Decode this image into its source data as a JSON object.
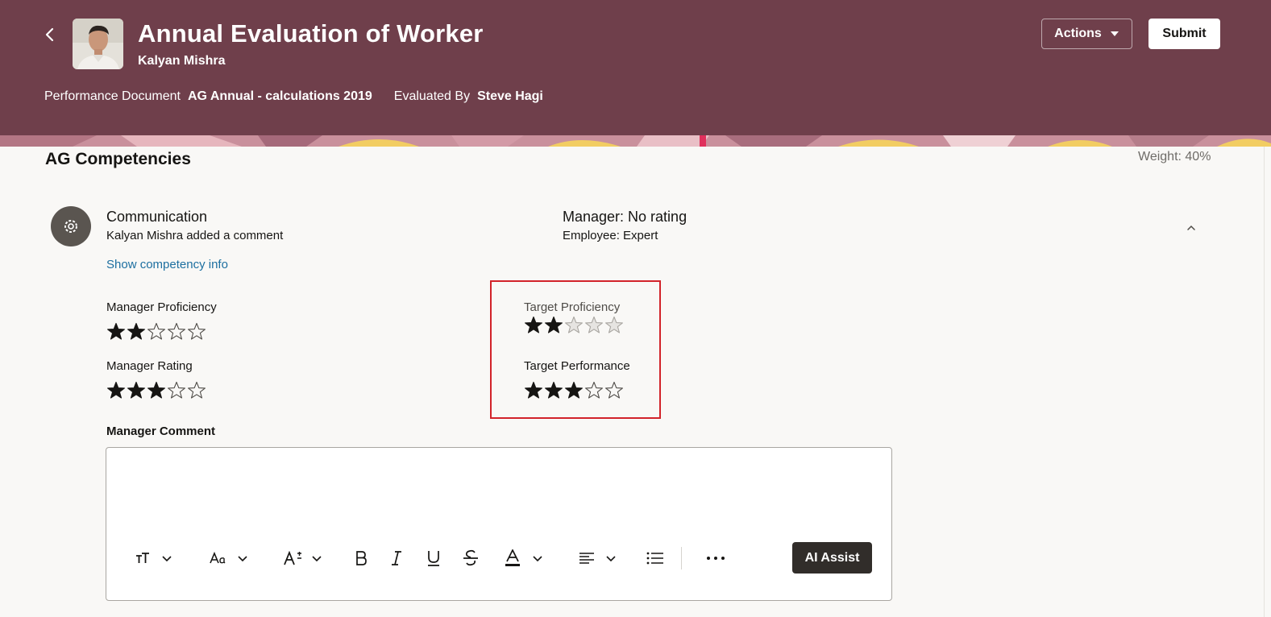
{
  "header": {
    "title": "Annual Evaluation of Worker",
    "subtitle": "Kalyan Mishra",
    "doc_label": "Performance Document",
    "doc_value": "AG Annual - calculations 2019",
    "evaluated_label": "Evaluated By",
    "evaluated_value": "Steve Hagi",
    "actions_label": "Actions",
    "submit_label": "Submit",
    "color": "#6f3f4b"
  },
  "section": {
    "title": "AG Competencies",
    "weight": "Weight: 40%"
  },
  "competency": {
    "name": "Communication",
    "note": "Kalyan Mishra added a comment",
    "manager_rating": "Manager: No rating",
    "employee_rating": "Employee: Expert",
    "show_info": "Show competency info"
  },
  "ratings": {
    "manager_proficiency": {
      "label": "Manager Proficiency",
      "value": 2,
      "max": 5
    },
    "manager_rating": {
      "label": "Manager Rating",
      "value": 3,
      "max": 5
    },
    "target_proficiency": {
      "label": "Target Proficiency",
      "value": 2,
      "max": 5
    },
    "target_performance": {
      "label": "Target Performance",
      "value": 3,
      "max": 5
    }
  },
  "comment": {
    "label": "Manager Comment",
    "ai_assist_label": "AI Assist"
  },
  "toolbar": [
    "text-size-icon",
    "font-icon",
    "font-size-icon",
    "bold-icon",
    "italic-icon",
    "underline-icon",
    "strikethrough-icon",
    "text-color-icon",
    "align-icon",
    "list-icon",
    "more-icon"
  ],
  "colors": {
    "highlight": "#d2232a",
    "link": "#1d6fa0",
    "accent": "#312d2a"
  }
}
